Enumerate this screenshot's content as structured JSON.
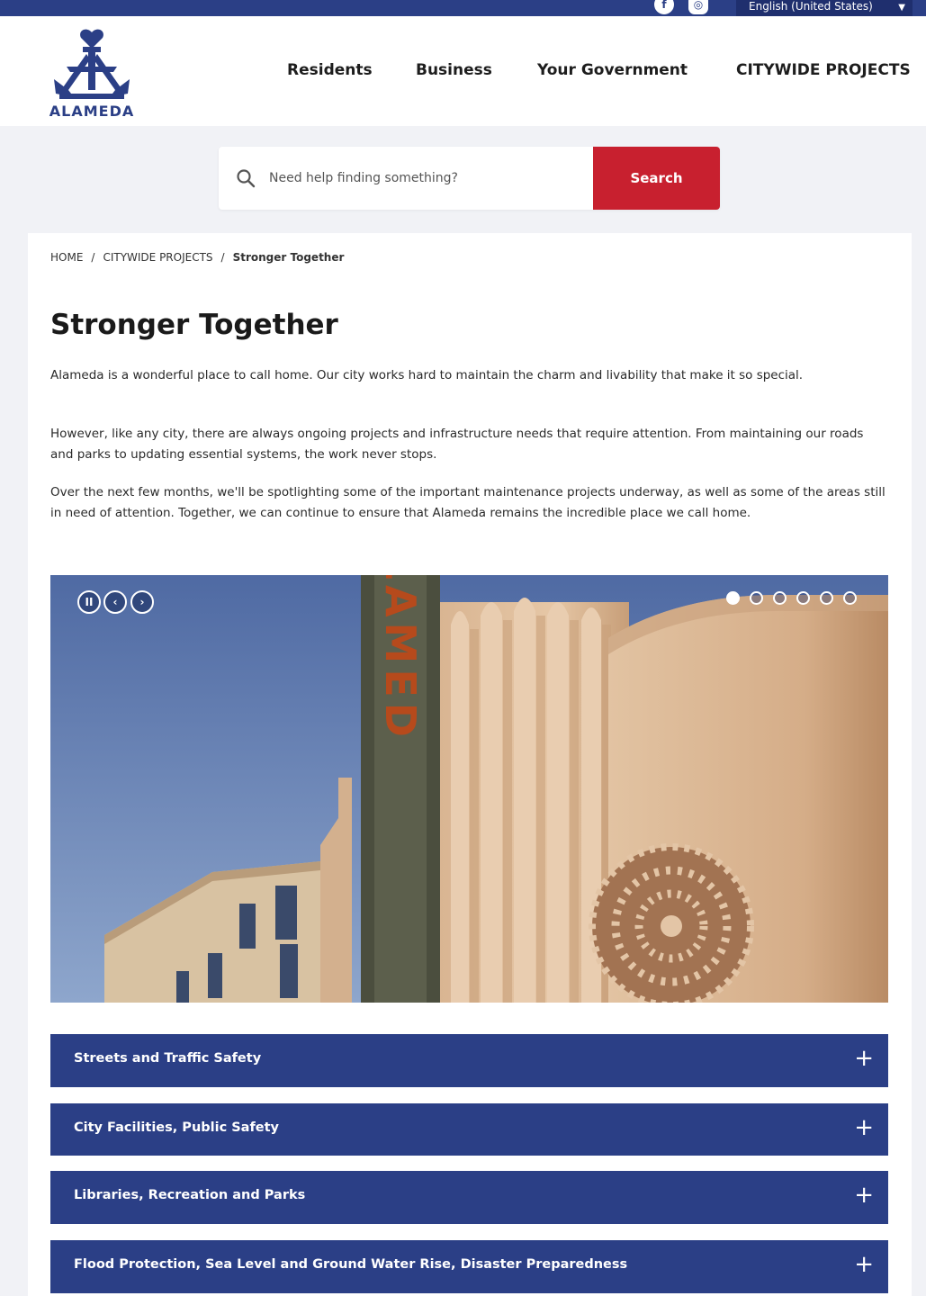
{
  "topbar": {
    "social": [
      "facebook-icon",
      "instagram-icon"
    ],
    "language": "English (United States)"
  },
  "header": {
    "logo_text": "ALAMEDA",
    "nav": [
      "Residents",
      "Business",
      "Your Government",
      "CITYWIDE PROJECTS"
    ]
  },
  "search": {
    "placeholder": "Need help finding something?",
    "button_label": "Search"
  },
  "breadcrumb": {
    "items": [
      "HOME",
      "CITYWIDE PROJECTS"
    ],
    "current": "Stronger Together"
  },
  "content": {
    "title": "Stronger Together",
    "paragraphs": [
      "Alameda is a wonderful place to call home. Our city works hard to maintain the charm and livability that make it so special.",
      "However, like any city, there are always ongoing projects and infrastructure needs that require attention. From maintaining our roads and parks to updating essential systems, the work never stops.",
      "Over the next few months, we'll be spotlighting some of the important maintenance projects underway, as well as some of the areas still in need of attention. Together, we can continue to ensure that Alameda remains the incredible place we call home."
    ]
  },
  "slideshow": {
    "controls": {
      "pause": "II",
      "prev": "‹",
      "next": "›"
    },
    "dot_count": 6,
    "active_index": 0,
    "sign_letters": "ALAMED"
  },
  "accordion": [
    {
      "label": "Streets and Traffic Safety",
      "icon": "+"
    },
    {
      "label": "City Facilities, Public Safety",
      "icon": "+"
    },
    {
      "label": "Libraries, Recreation and Parks",
      "icon": "+"
    },
    {
      "label": "Flood Protection, Sea Level and Ground Water Rise, Disaster Preparedness",
      "icon": "+"
    }
  ],
  "colors": {
    "brand_blue": "#2b3f86",
    "search_red": "#c8202f"
  }
}
